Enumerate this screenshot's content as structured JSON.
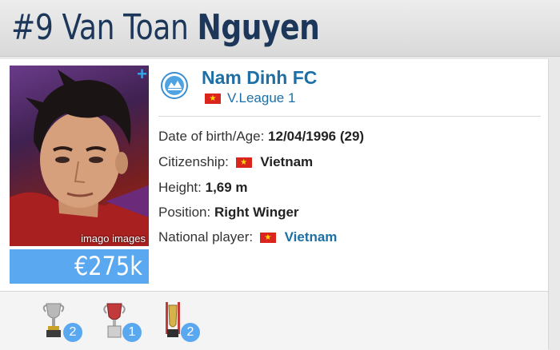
{
  "header": {
    "number": "#9",
    "first_name": "Van Toan",
    "last_name": "Nguyen"
  },
  "photo": {
    "credit": "imago images",
    "plus": "+"
  },
  "market_value": "€275k",
  "club": {
    "name": "Nam Dinh FC",
    "league": "V.League 1",
    "logo_icon": "club-crest-icon"
  },
  "details": [
    {
      "label": "Date of birth/Age:",
      "value": "12/04/1996 (29)"
    },
    {
      "label": "Citizenship:",
      "value": "Vietnam"
    },
    {
      "label": "Height:",
      "value": "1,69 m"
    },
    {
      "label": "Position:",
      "value": "Right Winger"
    },
    {
      "label": "National player:",
      "value": "Vietnam"
    }
  ],
  "trophies": [
    {
      "icon": "trophy-icon",
      "count": "2"
    },
    {
      "icon": "cup-icon",
      "count": "1"
    },
    {
      "icon": "award-icon",
      "count": "2"
    }
  ],
  "colors": {
    "brand_blue": "#1d6fa6",
    "badge_blue": "#5aa8f0",
    "title_navy": "#1d375a",
    "flag_red": "#da251d"
  }
}
